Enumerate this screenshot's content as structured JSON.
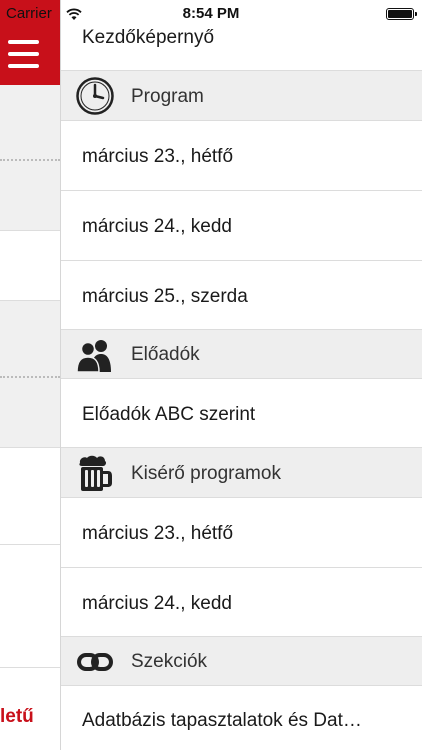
{
  "status_bar": {
    "carrier": "Carrier",
    "time": "8:54 PM"
  },
  "background": {
    "partial_label": "letű",
    "accent_color": "#c8101a"
  },
  "drawer": {
    "top_item": "Kezdőképernyő",
    "sections": [
      {
        "title": "Program",
        "icon": "clock-icon",
        "items": [
          "március 23., hétfő",
          "március 24., kedd",
          "március 25., szerda"
        ]
      },
      {
        "title": "Előadók",
        "icon": "people-icon",
        "items": [
          "Előadók ABC szerint"
        ]
      },
      {
        "title": "Kisérő programok",
        "icon": "beer-mug-icon",
        "items": [
          "március 23., hétfő",
          "március 24., kedd"
        ]
      },
      {
        "title": "Szekciók",
        "icon": "link-icon",
        "items": [
          "Adatbázis tapasztalatok és Dat…"
        ]
      }
    ]
  }
}
